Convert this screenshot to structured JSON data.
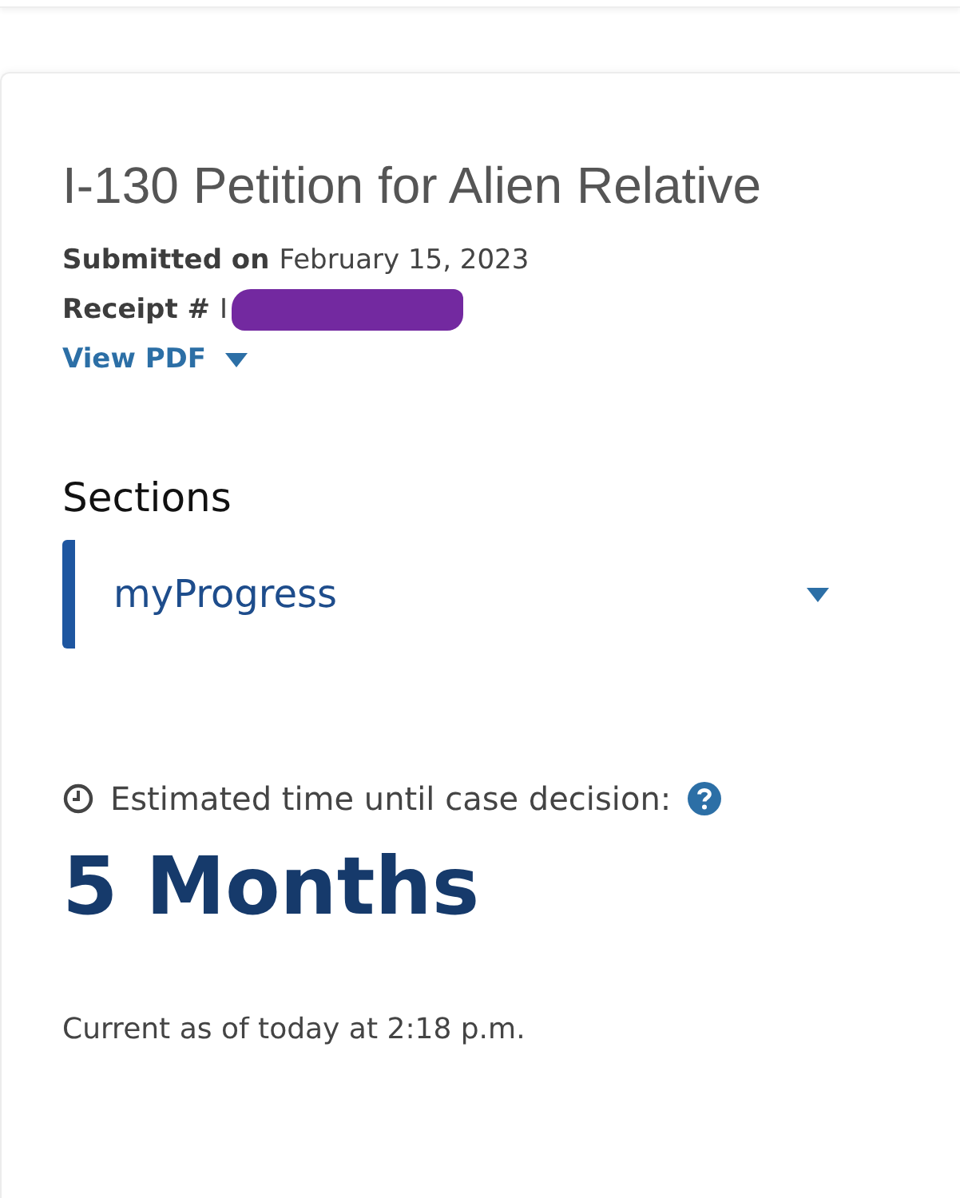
{
  "case": {
    "title": "I-130 Petition for Alien Relative",
    "submitted": {
      "label": "Submitted on",
      "value": "February 15, 2023"
    },
    "receipt": {
      "label": "Receipt #",
      "value": "I",
      "redacted": true
    },
    "view_pdf": {
      "label": "View PDF",
      "expanded": false
    }
  },
  "sections": {
    "heading": "Sections",
    "selected_item": {
      "label": "myProgress",
      "expanded": false
    }
  },
  "estimate": {
    "label": "Estimated time until case decision:",
    "value": "5 Months",
    "updated": "Current as of today at 2:18 p.m."
  }
}
